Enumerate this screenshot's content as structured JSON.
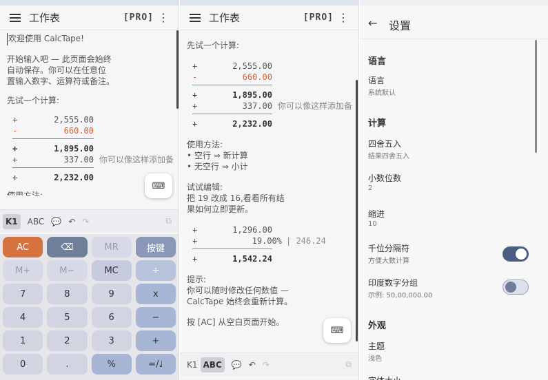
{
  "panel_left": {
    "title": "工作表",
    "pro": "[PRO]",
    "menu_icon": "menu-icon",
    "lines": {
      "welcome": "欢迎使用 CalcTape!",
      "intro1": "开始输入吧 — 此页面会始终",
      "intro2": "自动保存。你可以在任意位",
      "intro3": "置输入数字、运算符或备注。",
      "try": "先试一个计算:",
      "cut": "使用方法:"
    },
    "calc": [
      {
        "op": "+",
        "value": "2,555.00",
        "color": "normal"
      },
      {
        "op": "-",
        "value": "660.00",
        "color": "red"
      },
      {
        "op": "+",
        "value": "1,895.00",
        "color": "bold"
      },
      {
        "op": "+",
        "value": "337.00",
        "color": "normal",
        "note": "你可以像这样添加备"
      },
      {
        "op": "+",
        "value": "2,232.00",
        "color": "bold"
      }
    ],
    "toolbar": [
      "K1",
      "ABC"
    ],
    "keys": [
      [
        "AC",
        "⌫",
        "MR",
        "按键"
      ],
      [
        "M+",
        "M−",
        "MC",
        "÷"
      ],
      [
        "7",
        "8",
        "9",
        "x"
      ],
      [
        "4",
        "5",
        "6",
        "−"
      ],
      [
        "1",
        "2",
        "3",
        "+"
      ],
      [
        "0",
        ".",
        "%",
        "=/♩"
      ]
    ]
  },
  "panel_mid": {
    "title": "工作表",
    "pro": "[PRO]",
    "try": "先试一个计算:",
    "calc1": [
      {
        "op": "+",
        "value": "2,555.00"
      },
      {
        "op": "-",
        "value": "660.00"
      },
      {
        "op": "+",
        "value": "1,895.00"
      },
      {
        "op": "+",
        "value": "337.00",
        "note": "你可以像这样添加备"
      },
      {
        "op": "+",
        "value": "2,232.00"
      }
    ],
    "usage_title": "使用方法:",
    "usage1": "• 空行 ⇒ 新计算",
    "usage2": "• 无空行 ⇒ 小计",
    "edit_title": "试试编辑:",
    "edit1": "把 19 改成 16,看看所有结",
    "edit2": "果如何立即更新。",
    "calc2": [
      {
        "op": "+",
        "value": "1,296.00"
      },
      {
        "op": "+",
        "value": "19.00%",
        "note": "| 246.24"
      },
      {
        "op": "+",
        "value": "1,542.24"
      }
    ],
    "tip_title": "提示:",
    "tip1": "你可以随时修改任何数值 —",
    "tip2": "CalcTape 始终会重新计算。",
    "ac_hint": "按 [AC] 从空白页面开始。",
    "toolbar": [
      "K1",
      "ABC"
    ]
  },
  "settings": {
    "title": "设置",
    "sections": {
      "language": "语言",
      "calc": "计算",
      "appearance": "外观"
    },
    "items": {
      "language_label": "语言",
      "language_value": "系统默认",
      "rounding_label": "四舍五入",
      "rounding_value": "结果四舍五入",
      "decimals_label": "小数位数",
      "decimals_value": "2",
      "indent_label": "缩进",
      "indent_value": "10",
      "thousands_label": "千位分隔符",
      "thousands_value": "方便大数计算",
      "indian_label": "印度数字分组",
      "indian_value": "示例: 50,00,000.00",
      "theme_label": "主题",
      "theme_value": "浅色",
      "fontsize_label": "字体大小"
    },
    "toggles": {
      "thousands": true,
      "indian": false
    }
  }
}
